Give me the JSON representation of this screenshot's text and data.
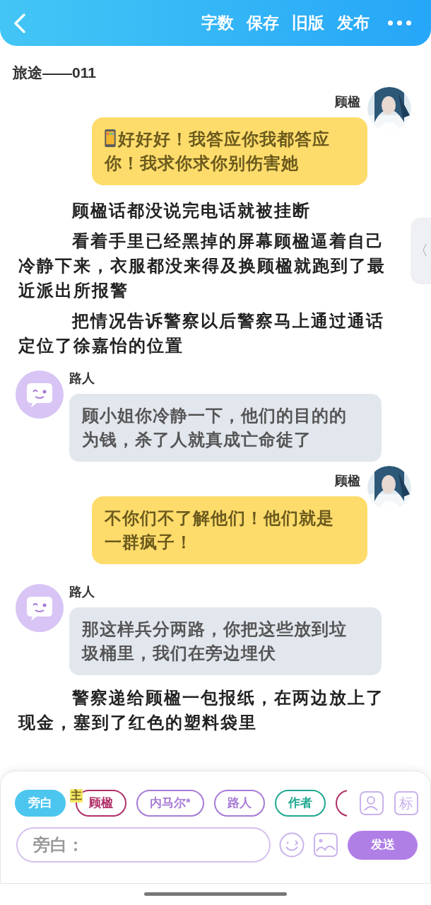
{
  "header": {
    "actions": [
      "字数",
      "保存",
      "旧版",
      "发布"
    ]
  },
  "title": "旅途——011",
  "messages": [
    {
      "kind": "right",
      "name": "顾楹",
      "text": "好好好！我答应你我都答应你！我求你求你别伤害她",
      "phone_icon": true
    },
    {
      "kind": "narration",
      "text": "顾楹话都没说完电话就被挂断"
    },
    {
      "kind": "narration",
      "text": "看着手里已经黑掉的屏幕顾楹逼着自己冷静下来，衣服都没来得及换顾楹就跑到了最近派出所报警"
    },
    {
      "kind": "narration",
      "text": "把情况告诉警察以后警察马上通过通话定位了徐嘉怡的位置"
    },
    {
      "kind": "left",
      "name": "路人",
      "text": "顾小姐你冷静一下，他们的目的的为钱，杀了人就真成亡命徒了"
    },
    {
      "kind": "right",
      "name": "顾楹",
      "text": "不你们不了解他们！他们就是一群疯子！"
    },
    {
      "kind": "left",
      "name": "路人",
      "text": "那这样兵分两路，你把这些放到垃圾桶里，我们在旁边埋伏"
    },
    {
      "kind": "narration",
      "text": "警察递给顾楹一包报纸，在两边放上了现金，塞到了红色的塑料袋里"
    }
  ],
  "roles": [
    {
      "label": "旁白",
      "selected": true,
      "color": "#4cc6ee"
    },
    {
      "label": "顾楹",
      "selected": false,
      "color": "#b0306a",
      "badge": "主"
    },
    {
      "label": "内马尔*",
      "selected": false,
      "color": "#a77bd6"
    },
    {
      "label": "路人",
      "selected": false,
      "color": "#a77bd6"
    },
    {
      "label": "作者",
      "selected": false,
      "color": "#20a890"
    }
  ],
  "input": {
    "placeholder": "旁白："
  },
  "send_label": "发送",
  "mark_button": "标",
  "side_tab": "〈"
}
